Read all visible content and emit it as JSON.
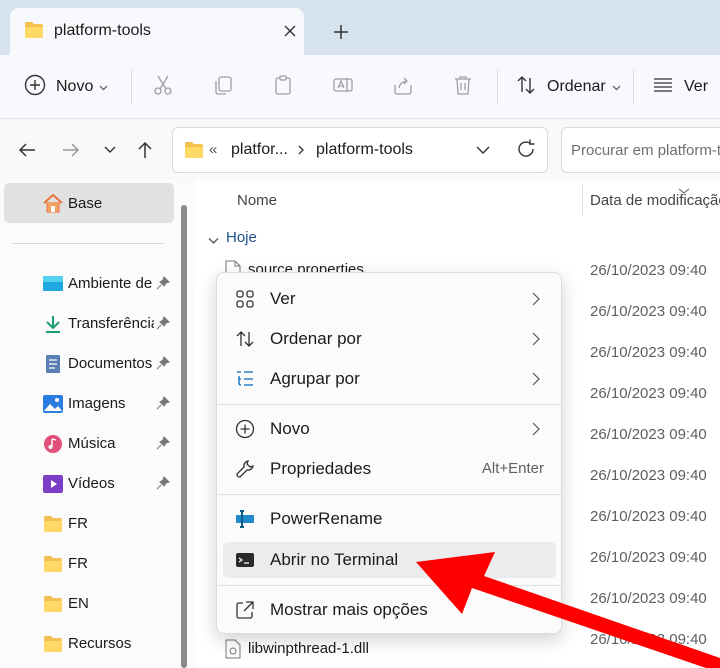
{
  "window": {
    "tab_title": "platform-tools",
    "new_tab_symbol": "+"
  },
  "toolbar": {
    "new_label": "Novo",
    "sort_label": "Ordenar",
    "view_label": "Ver",
    "icons": [
      "cut-icon",
      "copy-icon",
      "paste-icon",
      "rename-icon",
      "share-icon",
      "delete-icon"
    ]
  },
  "address": {
    "overflow": "«",
    "segments": [
      "platfor...",
      "platform-tools"
    ],
    "search_placeholder": "Procurar em platform-tools"
  },
  "sidebar": {
    "home": "Base",
    "items": [
      {
        "label": "Ambiente de Trabalho",
        "icon": "desktop-icon",
        "pinned": true
      },
      {
        "label": "Transferências",
        "icon": "download-icon",
        "pinned": true
      },
      {
        "label": "Documentos",
        "icon": "documents-icon",
        "pinned": true
      },
      {
        "label": "Imagens",
        "icon": "pictures-icon",
        "pinned": true
      },
      {
        "label": "Música",
        "icon": "music-icon",
        "pinned": true
      },
      {
        "label": "Vídeos",
        "icon": "videos-icon",
        "pinned": true
      },
      {
        "label": "FR",
        "icon": "folder-icon",
        "pinned": false
      },
      {
        "label": "FR",
        "icon": "folder-icon",
        "pinned": false
      },
      {
        "label": "EN",
        "icon": "folder-icon",
        "pinned": false
      },
      {
        "label": "Recursos",
        "icon": "folder-icon",
        "pinned": false
      }
    ]
  },
  "filelist": {
    "columns": {
      "name": "Nome",
      "date": "Data de modificação"
    },
    "group": "Hoje",
    "rows": [
      {
        "name": "source.properties",
        "date": "26/10/2023 09:40"
      },
      {
        "name": "",
        "date": "26/10/2023 09:40"
      },
      {
        "name": "",
        "date": "26/10/2023 09:40"
      },
      {
        "name": "",
        "date": "26/10/2023 09:40"
      },
      {
        "name": "",
        "date": "26/10/2023 09:40"
      },
      {
        "name": "",
        "date": "26/10/2023 09:40"
      },
      {
        "name": "",
        "date": "26/10/2023 09:40"
      },
      {
        "name": "",
        "date": "26/10/2023 09:40"
      },
      {
        "name": "",
        "date": "26/10/2023 09:40"
      },
      {
        "name": "",
        "date": "26/10/2023 09:40"
      },
      {
        "name": "libwinpthread-1.dll",
        "date": ""
      }
    ]
  },
  "context_menu": {
    "items": [
      {
        "label": "Ver",
        "icon": "view-grid-icon",
        "submenu": true,
        "accel": ""
      },
      {
        "label": "Ordenar por",
        "icon": "sort-icon",
        "submenu": true,
        "accel": ""
      },
      {
        "label": "Agrupar por",
        "icon": "group-icon",
        "submenu": true,
        "accel": ""
      },
      {
        "label": "Novo",
        "icon": "new-icon",
        "submenu": true,
        "accel": ""
      },
      {
        "label": "Propriedades",
        "icon": "wrench-icon",
        "submenu": false,
        "accel": "Alt+Enter"
      },
      {
        "label": "PowerRename",
        "icon": "powerrename-icon",
        "submenu": false,
        "accel": ""
      },
      {
        "label": "Abrir no Terminal",
        "icon": "terminal-icon",
        "submenu": false,
        "accel": ""
      },
      {
        "label": "Mostrar mais opções",
        "icon": "more-options-icon",
        "submenu": false,
        "accel": ""
      }
    ]
  },
  "colors": {
    "accent": "#0067c0",
    "folder": "#f4c04e",
    "annotation": "#ff0000"
  }
}
